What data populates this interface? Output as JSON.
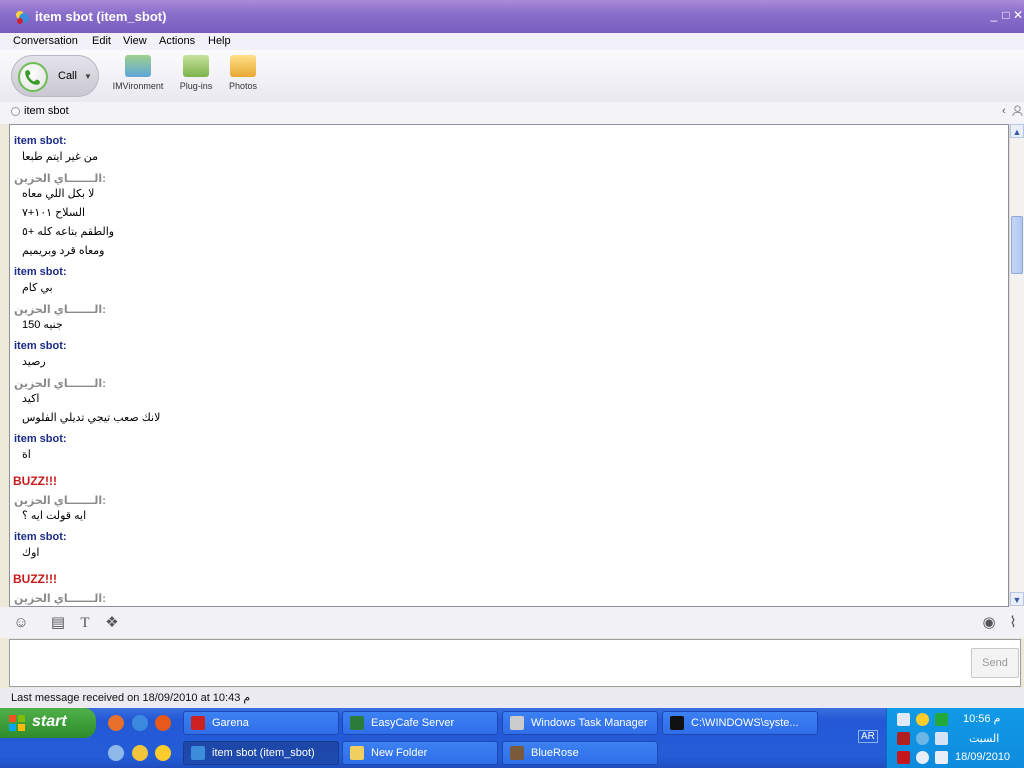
{
  "window": {
    "title": "item sbot (item_sbot)",
    "minimize": "_",
    "maximize": "□",
    "close": "✕"
  },
  "menu": {
    "items": [
      "Conversation",
      "Edit",
      "View",
      "Actions",
      "Help"
    ]
  },
  "toolbar": {
    "call_label": "Call",
    "items": [
      {
        "label": "IMVironment"
      },
      {
        "label": "Plug-ins"
      },
      {
        "label": "Photos"
      }
    ]
  },
  "contact": {
    "name": "item sbot",
    "collapse": "‹",
    "profile_icon": "person-icon"
  },
  "messages": [
    {
      "type": "message",
      "sender": "item sbot:",
      "style": "blue",
      "lines": [
        "من غير ايتم طبعا"
      ]
    },
    {
      "type": "message",
      "sender": "الـــــــاي الحزين:",
      "style": "grey",
      "lines": [
        "لا بكل اللي معاه",
        "السلاح ١٠١+٧",
        "والطقم بتاعه كله +٥",
        "ومعاه قرد وبريميم"
      ]
    },
    {
      "type": "message",
      "sender": "item sbot:",
      "style": "blue",
      "lines": [
        "بي كام"
      ]
    },
    {
      "type": "message",
      "sender": "الـــــــاي الحزين:",
      "style": "grey",
      "lines": [
        "150 جنيه"
      ]
    },
    {
      "type": "message",
      "sender": "item sbot:",
      "style": "blue",
      "lines": [
        "رصيد"
      ]
    },
    {
      "type": "message",
      "sender": "الـــــــاي الحزين:",
      "style": "grey",
      "lines": [
        "اكيد",
        "لانك صعب تيجي تديلي الفلوس"
      ]
    },
    {
      "type": "message",
      "sender": "item sbot:",
      "style": "blue",
      "lines": [
        "اة"
      ]
    },
    {
      "type": "buzz",
      "text": "BUZZ!!!"
    },
    {
      "type": "message",
      "sender": "الـــــــاي الحزين:",
      "style": "grey",
      "lines": [
        "ايه قولت ايه ؟"
      ]
    },
    {
      "type": "message",
      "sender": "item sbot:",
      "style": "blue",
      "lines": [
        "اوك"
      ]
    },
    {
      "type": "buzz",
      "text": "BUZZ!!!"
    },
    {
      "type": "message",
      "sender": "الـــــــاي الحزين:",
      "style": "grey",
      "lines": []
    }
  ],
  "format_tools": {
    "text_label": "T"
  },
  "send_label": "Send",
  "status": "Last message received on 18/09/2010 at 10:43 م",
  "taskbar": {
    "start_label": "start",
    "row1": [
      {
        "label": "Garena"
      },
      {
        "label": "EasyCafe Server"
      },
      {
        "label": "Windows Task Manager"
      },
      {
        "label": "C:\\WINDOWS\\syste..."
      }
    ],
    "row2": [
      {
        "label": "item sbot (item_sbot)",
        "active": true
      },
      {
        "label": "New Folder"
      },
      {
        "label": "BlueRose"
      }
    ],
    "language": "AR"
  },
  "clock": {
    "time": "10:56 م",
    "day": "السبت",
    "date": "18/09/2010"
  }
}
